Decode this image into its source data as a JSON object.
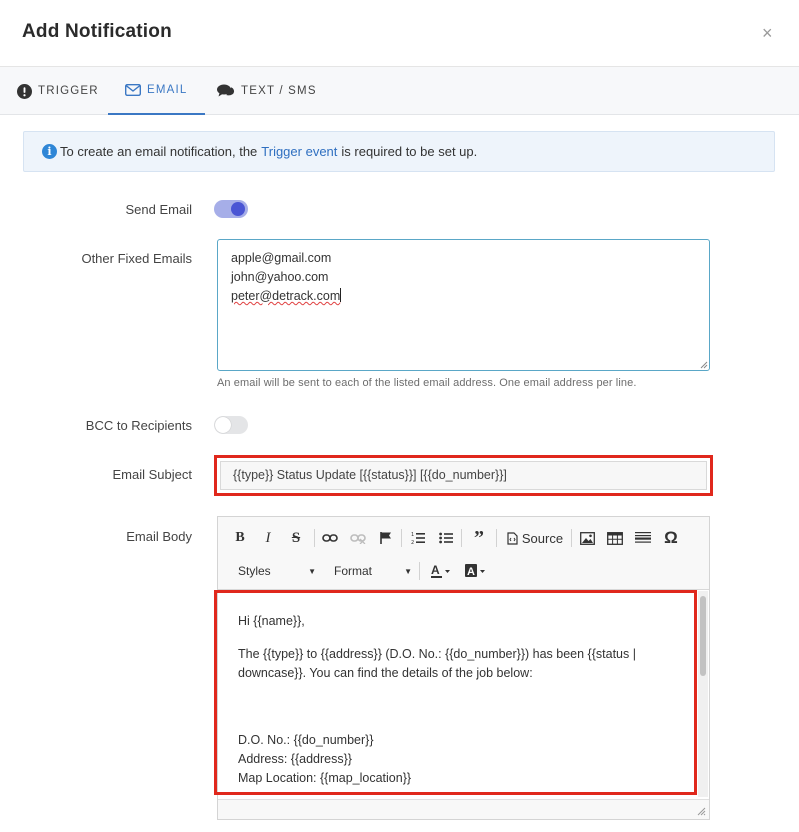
{
  "modal": {
    "title": "Add Notification",
    "close": "×"
  },
  "tabs": [
    {
      "label": "TRIGGER",
      "icon": "exclamation-circle-icon"
    },
    {
      "label": "EMAIL",
      "icon": "envelope-icon",
      "active": true
    },
    {
      "label": "TEXT / SMS",
      "icon": "comments-icon"
    }
  ],
  "alert": {
    "icon": "info-icon",
    "text_before": "To create an email notification, the",
    "link": "Trigger event",
    "text_after": "is required to be set up."
  },
  "form": {
    "send_email": {
      "label": "Send Email",
      "enabled": true
    },
    "other_emails": {
      "label": "Other Fixed Emails",
      "lines": [
        "apple@gmail.com",
        "john@yahoo.com",
        "peter@detrack.com"
      ],
      "help": "An email will be sent to each of the listed email address. One email address per line."
    },
    "bcc": {
      "label": "BCC to Recipients",
      "enabled": false
    },
    "subject": {
      "label": "Email Subject",
      "value": "{{type}} Status Update [{{status}}] [{{do_number}}]"
    },
    "body": {
      "label": "Email Body",
      "toolbar": {
        "buttons": [
          "bold",
          "italic",
          "strikethrough",
          "link",
          "unlink",
          "anchor",
          "numbered-list",
          "bulleted-list",
          "blockquote",
          "source",
          "image",
          "table",
          "horizontal-rule",
          "special-char"
        ],
        "source_label": "Source",
        "styles_label": "Styles",
        "format_label": "Format"
      },
      "paragraphs": [
        "Hi {{name}},",
        "The {{type}} to {{address}} (D.O. No.: {{do_number}}) has been {{status | downcase}}. You can find the details of the job below:"
      ],
      "details": [
        "D.O. No.: {{do_number}}",
        "Address: {{address}}",
        "Map Location: {{map_location}}"
      ]
    }
  },
  "colors": {
    "accent": "#3b78c4",
    "highlight": "#e0281c",
    "toggle_on": "#4a55d4"
  }
}
